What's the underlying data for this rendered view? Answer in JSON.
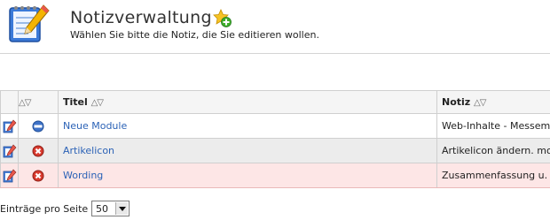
{
  "header": {
    "title": "Notizverwaltung",
    "subtitle": "Wählen Sie bitte die Notiz, die Sie editieren wollen.",
    "app_icon": "notepad-pencil-icon",
    "add_icon": "add-star-icon"
  },
  "table": {
    "columns": {
      "status_sort": "△▽",
      "title": "Titel",
      "title_sort": "△▽",
      "note": "Notiz",
      "note_sort": "△▽"
    },
    "rows": [
      {
        "status_icon": "active-icon",
        "title": "Neue Module",
        "note": "Web-Inhalte - Messem"
      },
      {
        "status_icon": "inactive-icon",
        "title": "Artikelicon",
        "note": "Artikelicon ändern. mo"
      },
      {
        "status_icon": "inactive-icon",
        "title": "Wording",
        "note": "Zusammenfassung u."
      }
    ]
  },
  "pager": {
    "label": "Einträge pro Seite",
    "selected": "50"
  },
  "colors": {
    "link": "#2b62b6",
    "highlight_row": "#fde6e6",
    "even_row": "#ececec"
  }
}
